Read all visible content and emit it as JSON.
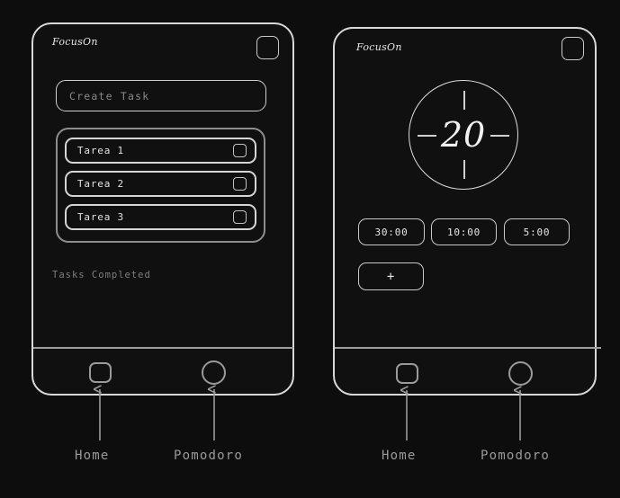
{
  "screens": [
    {
      "id": "home",
      "app_name": "FocusOn",
      "top_button_icon": "rounded-square-icon",
      "input": {
        "placeholder": "Create Task",
        "value": ""
      },
      "tasks": [
        {
          "label": "Tarea 1",
          "checked": false
        },
        {
          "label": "Tarea 2",
          "checked": false
        },
        {
          "label": "Tarea 3",
          "checked": false
        }
      ],
      "section_caption": "Tasks Completed",
      "nav": [
        {
          "label": "Home",
          "icon": "square-icon"
        },
        {
          "label": "Pomodoro",
          "icon": "circle-icon"
        }
      ]
    },
    {
      "id": "pomodoro",
      "app_name": "FocusOn",
      "top_button_icon": "rounded-square-icon",
      "timer": {
        "value": "20",
        "ticks": 4
      },
      "presets": [
        {
          "label": "30:00"
        },
        {
          "label": "10:00"
        },
        {
          "label": "5:00"
        }
      ],
      "add_preset_label": "+",
      "nav": [
        {
          "label": "Home",
          "icon": "square-icon"
        },
        {
          "label": "Pomodoro",
          "icon": "circle-icon"
        }
      ]
    }
  ],
  "annotations": [
    {
      "label": "Home",
      "target": "home-nav-left"
    },
    {
      "label": "Pomodoro",
      "target": "pomodoro-nav-left"
    },
    {
      "label": "Home",
      "target": "home-nav-right"
    },
    {
      "label": "Pomodoro",
      "target": "pomodoro-nav-right"
    }
  ],
  "colors": {
    "background": "#0d0d0d",
    "frame_stroke": "#d8d8d8",
    "muted_text": "#9a9a9a",
    "primary_text": "#e6e6e6"
  }
}
